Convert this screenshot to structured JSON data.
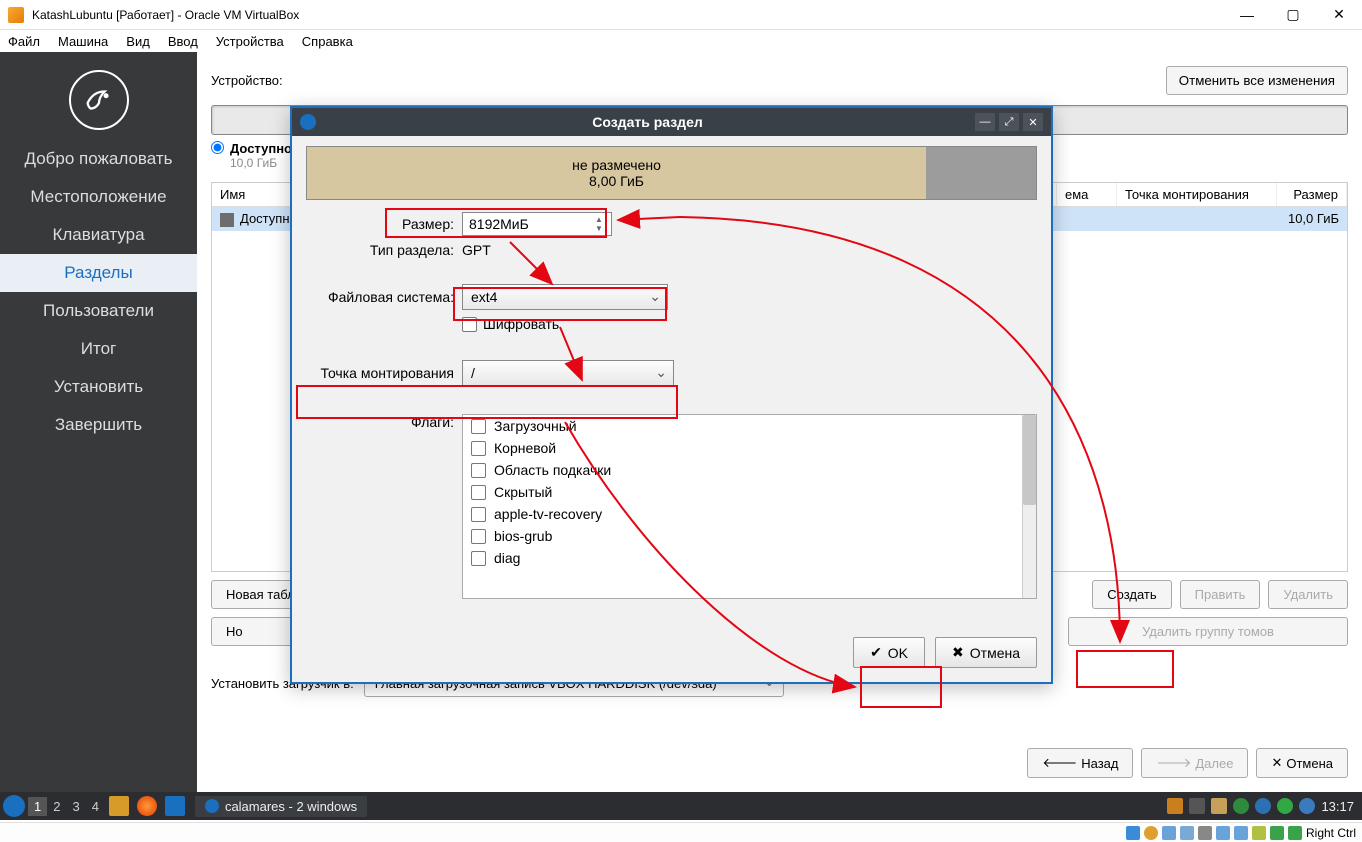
{
  "win_title": "KatashLubuntu [Работает] - Oracle VM VirtualBox",
  "vb_menu": [
    "Файл",
    "Машина",
    "Вид",
    "Ввод",
    "Устройства",
    "Справка"
  ],
  "sidebar_steps": [
    "Добро пожаловать",
    "Местоположение",
    "Клавиатура",
    "Разделы",
    "Пользователи",
    "Итог",
    "Установить",
    "Завершить"
  ],
  "sidebar_active_index": 3,
  "device_label": "Устройство:",
  "undo_btn": "Отменить все изменения",
  "disk_free_label": "Доступно",
  "disk_free_size": "10,0 ГиБ",
  "pt_headers": {
    "name": "Имя",
    "fs": "ема",
    "mount": "Точка монтирования",
    "size": "Размер"
  },
  "pt_row": {
    "name": "Доступн",
    "size": "10,0 ГиБ"
  },
  "btns_row1": {
    "newtable": "Новая табл",
    "create": "Создать",
    "edit": "Править",
    "delete": "Удалить"
  },
  "btns_row2": {
    "new_something": "Но",
    "rm_vg": "Удалить группу томов"
  },
  "boot_label": "Установить загрузчик в:",
  "boot_value": "Главная загрузочная запись VBOX HARDDISK (/dev/sda)",
  "nav": {
    "back": "Назад",
    "next": "Далее",
    "cancel": "Отмена"
  },
  "dialog": {
    "title": "Создать раздел",
    "preview_label": "не размечено",
    "preview_size": "8,00 ГиБ",
    "size_label": "Размер:",
    "size_value": "8192МиБ",
    "type_label": "Тип раздела:",
    "type_value": "GPT",
    "fs_label": "Файловая система:",
    "fs_value": "ext4",
    "encrypt_label": "Шифровать",
    "mount_label": "Точка монтирования",
    "mount_value": "/",
    "flags_label": "Флаги:",
    "flags": [
      "Загрузочный",
      "Корневой",
      "Область подкачки",
      "Скрытый",
      "apple-tv-recovery",
      "bios-grub",
      "diag"
    ],
    "ok": "OK",
    "cancel": "Отмена"
  },
  "taskbar": {
    "workspaces": [
      "1",
      "2",
      "3",
      "4"
    ],
    "task_label": "calamares - 2 windows",
    "clock": "13:17"
  },
  "vb_status_key": "Right Ctrl"
}
